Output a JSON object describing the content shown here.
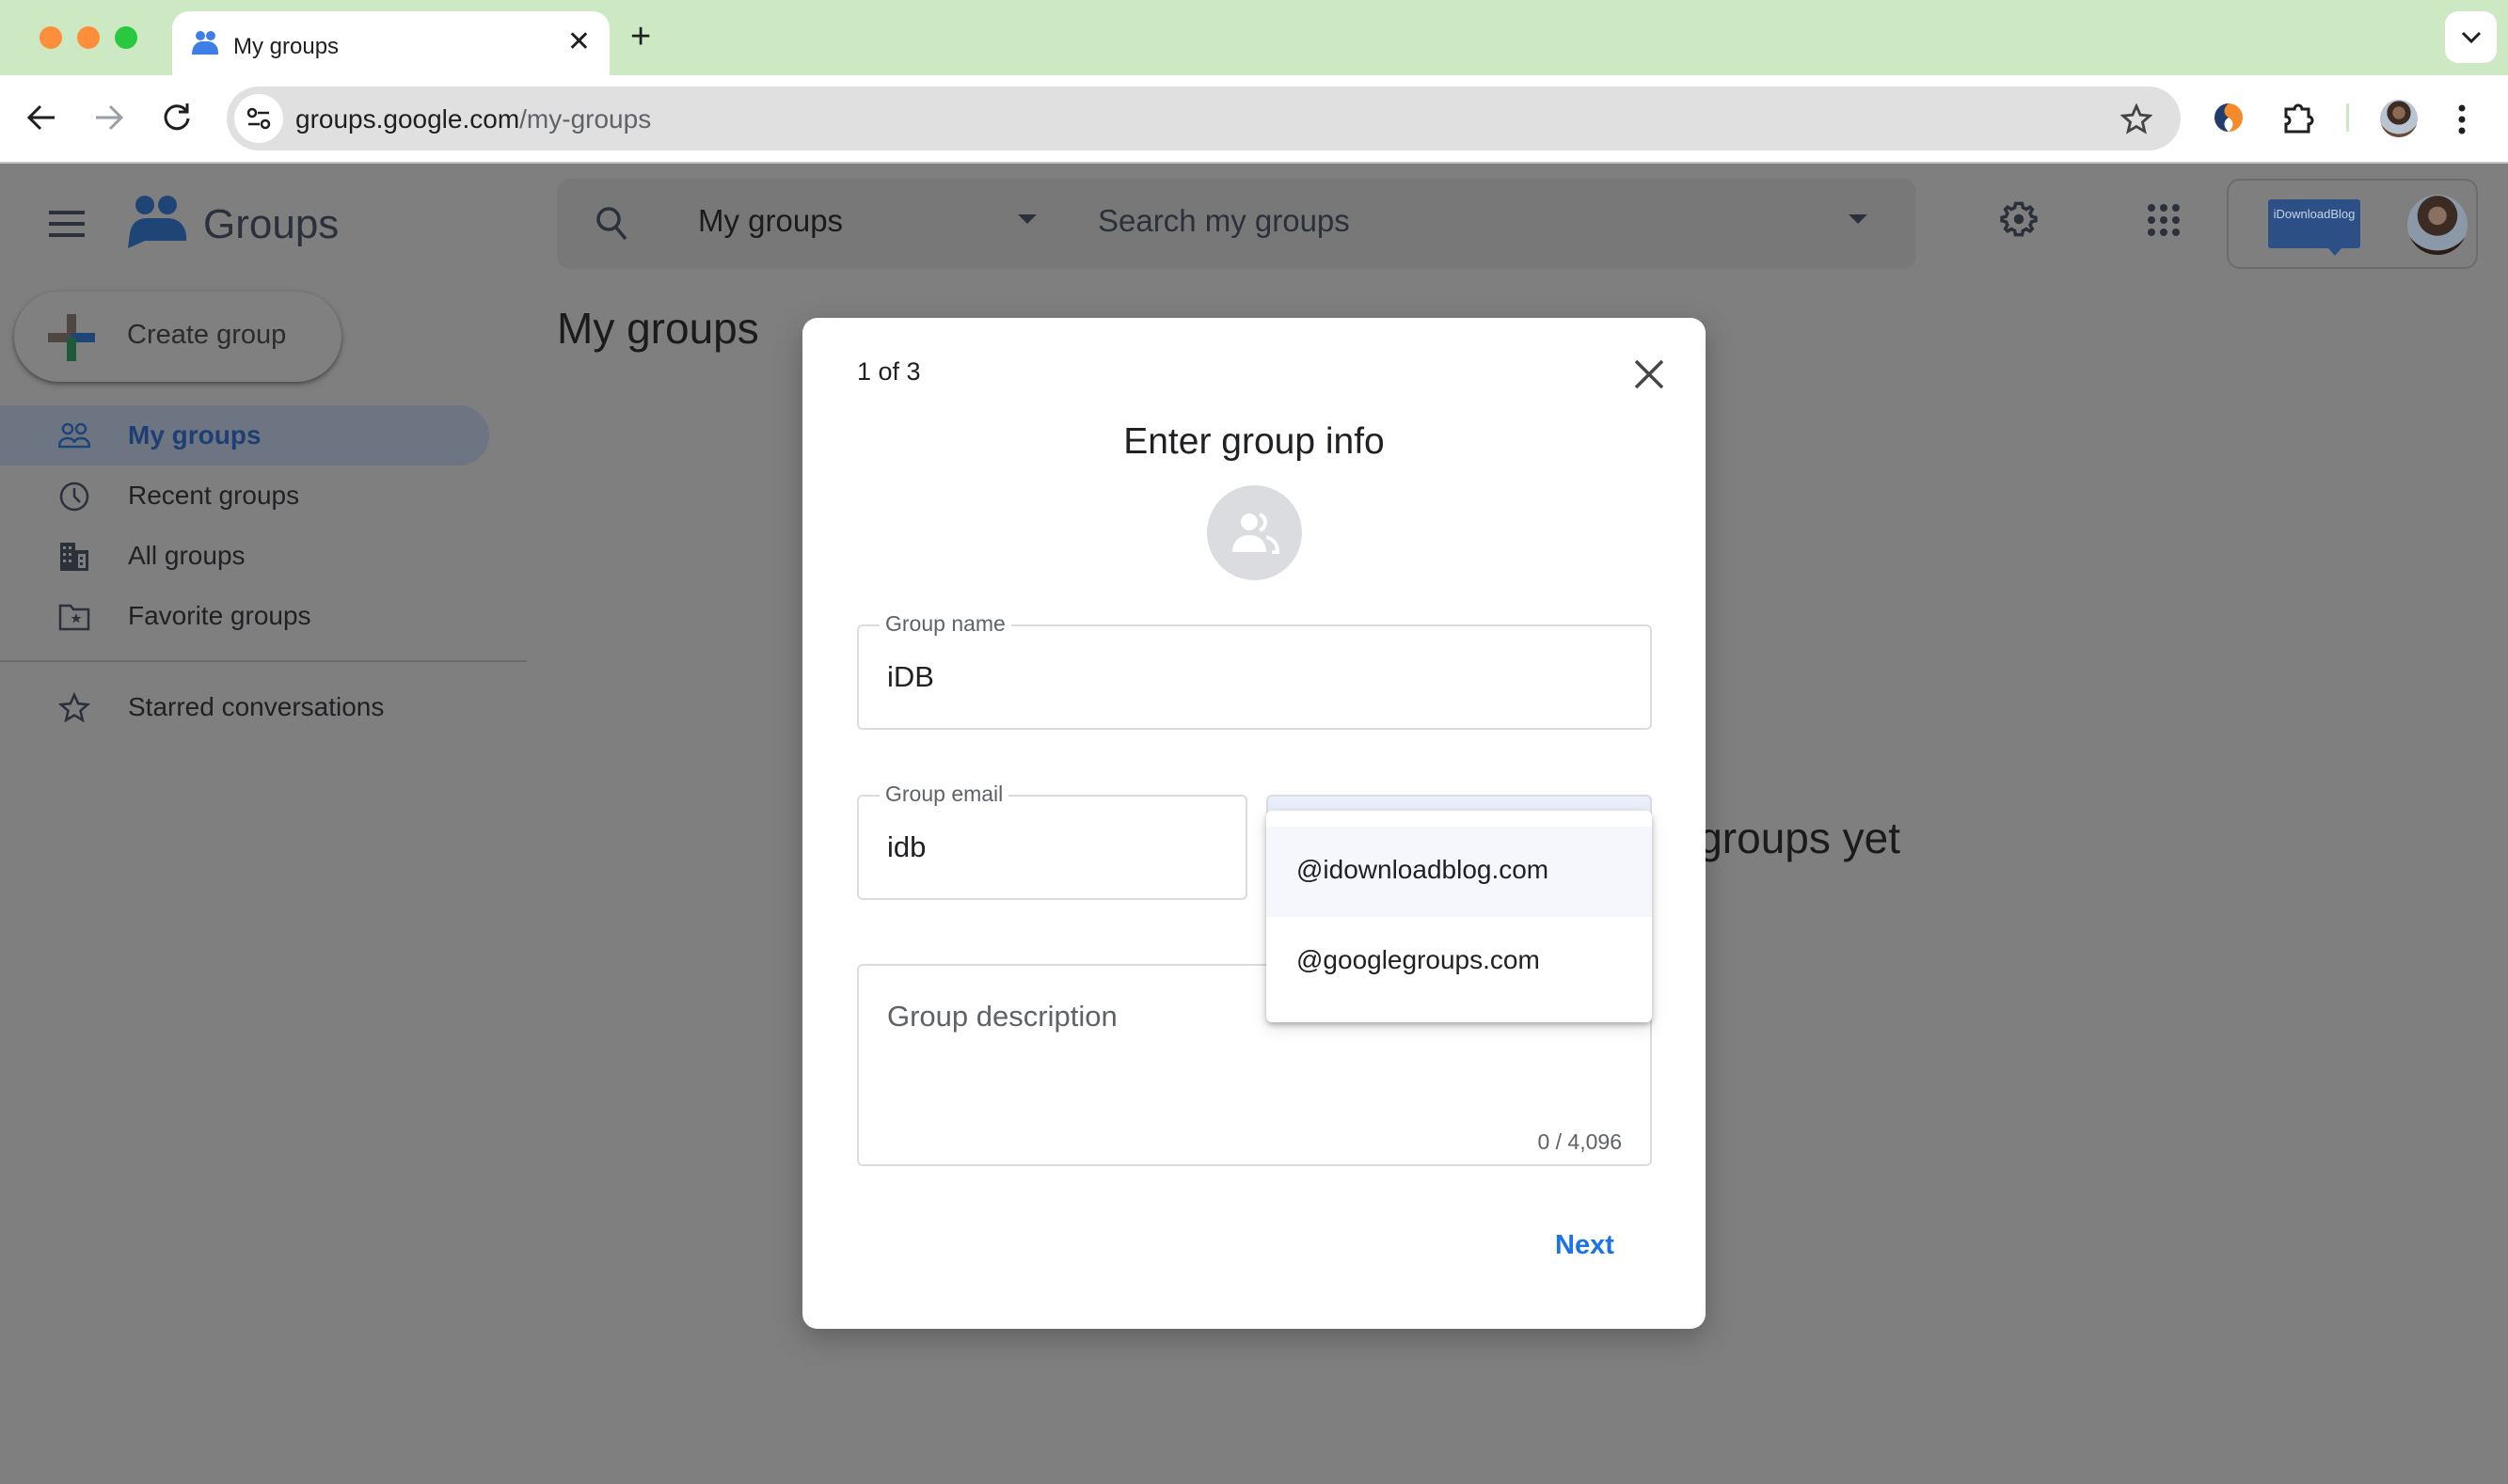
{
  "browser": {
    "tab": {
      "title": "My groups",
      "close_glyph": "✕"
    },
    "new_tab_glyph": "+",
    "url": {
      "host": "groups.google.com",
      "path": "/my-groups"
    },
    "traffic_lights": {
      "close": "#fe8f3a",
      "minimize": "#fe8f3a",
      "zoom": "#28c840"
    },
    "toolbar_icons": [
      "back-icon",
      "forward-icon",
      "reload-icon",
      "site-info-icon",
      "bookmark-star-icon",
      "extension-s-icon",
      "extensions-puzzle-icon",
      "profile-avatar",
      "chrome-menu-icon"
    ]
  },
  "app": {
    "logo_text": "Groups",
    "search": {
      "scope": "My groups",
      "placeholder": "Search my groups"
    },
    "create_group_label": "Create group",
    "brand_badge_text": "iDownloadBlog",
    "page_title": "My groups",
    "empty_state_text": "groups yet",
    "sidebar": {
      "items": [
        {
          "label": "My groups",
          "icon": "people-outline-icon",
          "active": true
        },
        {
          "label": "Recent groups",
          "icon": "clock-icon",
          "active": false
        },
        {
          "label": "All groups",
          "icon": "building-icon",
          "active": false
        },
        {
          "label": "Favorite groups",
          "icon": "folder-star-icon",
          "active": false
        }
      ],
      "starred": {
        "label": "Starred conversations",
        "icon": "star-outline-icon"
      }
    },
    "colors": {
      "accent_blue": "#1a73e8",
      "active_nav_text": "#1f3f73",
      "overlay_gray": "#7f7f7f",
      "tabbar_green": "#cce9c3"
    }
  },
  "dialog": {
    "step": "1 of 3",
    "title": "Enter group info",
    "group_name": {
      "label": "Group name",
      "value": "iDB"
    },
    "group_email": {
      "label": "Group email",
      "value": "idb"
    },
    "domain_options": [
      "@idownloadblog.com",
      "@googlegroups.com"
    ],
    "highlighted_option": "@idownloadblog.com",
    "description": {
      "placeholder": "Group description",
      "counter": "0 / 4,096"
    },
    "next_label": "Next"
  }
}
